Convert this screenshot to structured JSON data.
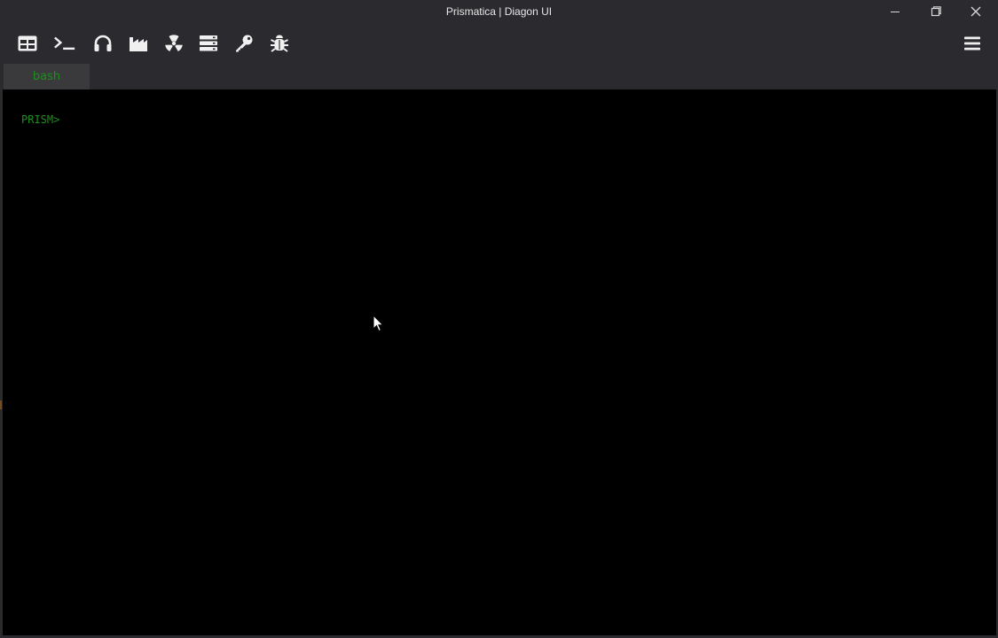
{
  "window": {
    "title": "Prismatica | Diagon UI"
  },
  "toolbar": {
    "icons": [
      {
        "name": "table-icon",
        "label": "Table"
      },
      {
        "name": "terminal-icon",
        "label": "Terminal"
      },
      {
        "name": "headphones-icon",
        "label": "Audio"
      },
      {
        "name": "factory-icon",
        "label": "Factory"
      },
      {
        "name": "radiation-icon",
        "label": "Radiation"
      },
      {
        "name": "server-icon",
        "label": "Server"
      },
      {
        "name": "key-icon",
        "label": "Key"
      },
      {
        "name": "bug-icon",
        "label": "Debug"
      }
    ],
    "menu_icon": "hamburger-menu-icon"
  },
  "tabs": [
    {
      "label": "bash",
      "active": true
    }
  ],
  "terminal": {
    "prompt": "PRISM>"
  },
  "colors": {
    "titlebar_bg": "#2b2a2e",
    "terminal_bg": "#000000",
    "prompt_green": "#1f8f1f",
    "tab_bg": "#3a3a3c",
    "icon_color": "#f0f0f0"
  }
}
